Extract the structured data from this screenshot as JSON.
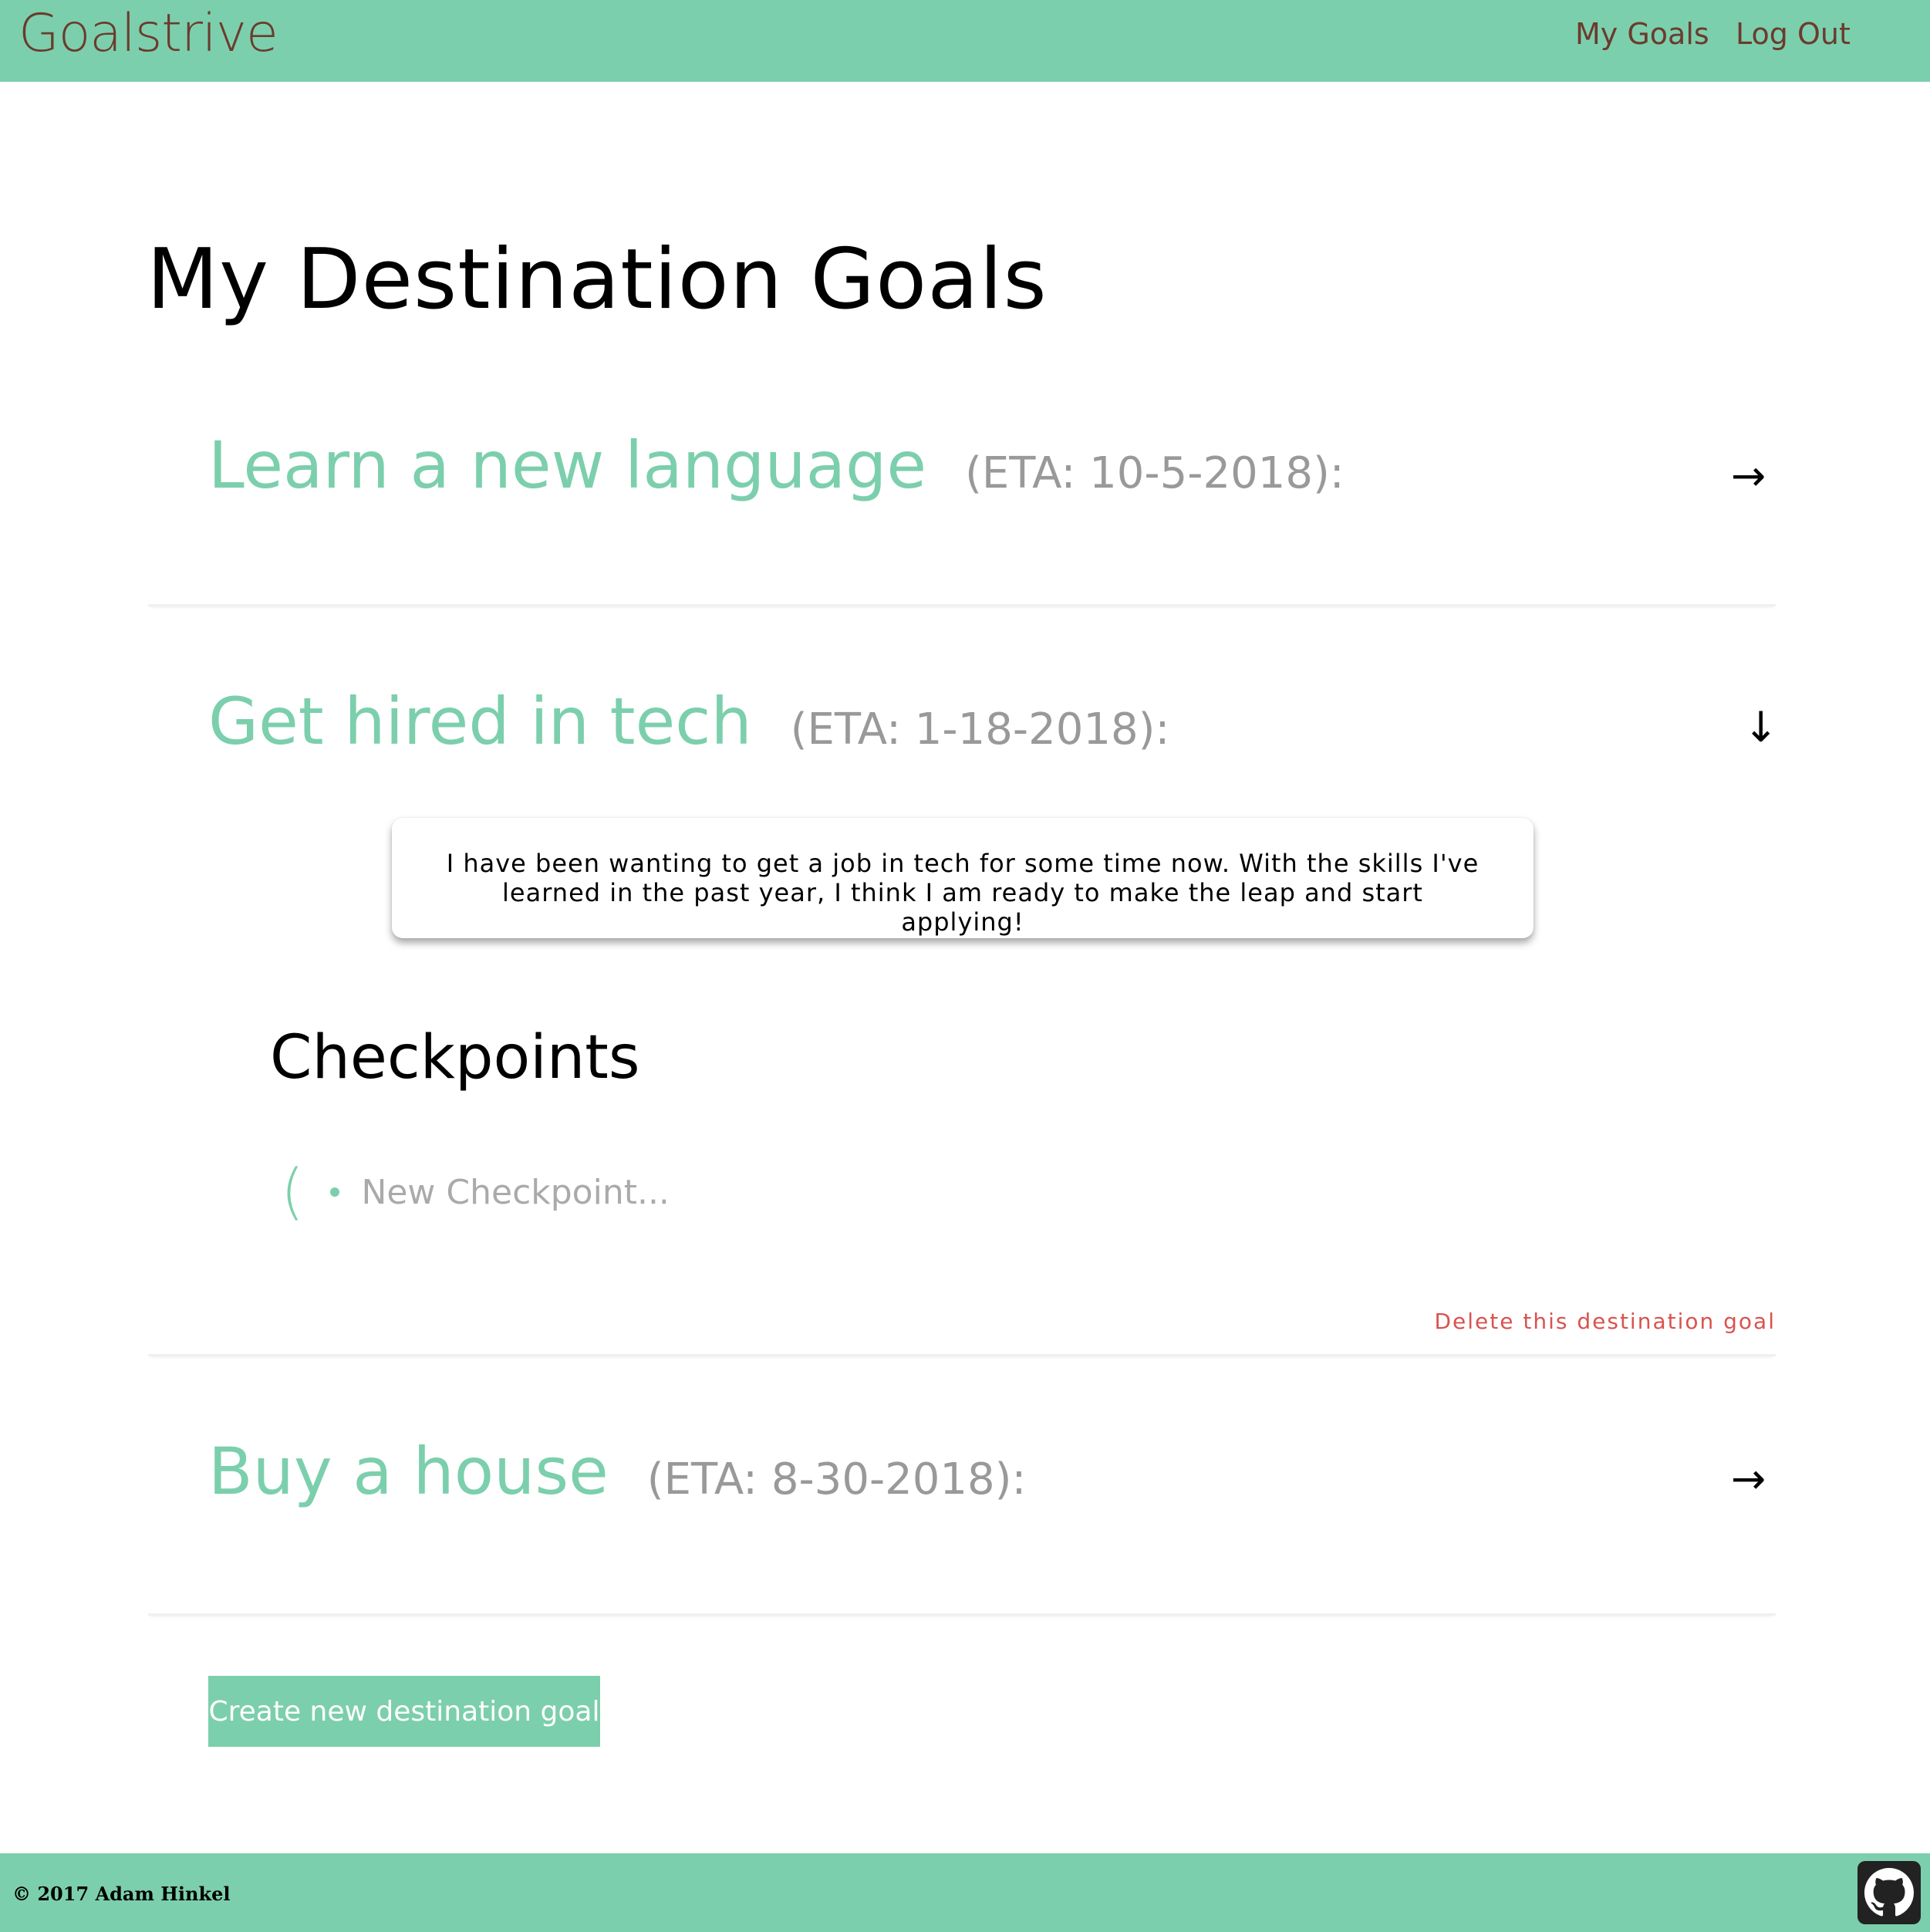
{
  "header": {
    "brand": "Goalstrive",
    "nav": {
      "my_goals": "My Goals",
      "log_out": "Log Out"
    }
  },
  "page_title": "My Destination Goals",
  "goals": [
    {
      "title": "Learn a new language",
      "eta": "(ETA: 10-5-2018):",
      "arrow": "→",
      "expanded": false
    },
    {
      "title": "Get hired in tech",
      "eta": "(ETA: 1-18-2018):",
      "arrow": "↓",
      "expanded": true,
      "description": "I have been wanting to get a job in tech for some time now. With the skills I've learned in the past year, I think I am ready to make the leap and start applying!",
      "checkpoints_title": "Checkpoints",
      "checkpoint_paren": "(",
      "new_checkpoint_placeholder": "New Checkpoint...",
      "delete_label": "Delete this destination goal"
    },
    {
      "title": "Buy a house",
      "eta": "(ETA: 8-30-2018):",
      "arrow": "→",
      "expanded": false
    }
  ],
  "create_button": "Create new destination goal",
  "footer": {
    "copyright": "© 2017 Adam Hinkel",
    "github_icon": "github-icon"
  },
  "colors": {
    "accent": "#7ccfac",
    "brand_text": "#6b3b2e",
    "eta_text": "#999999",
    "danger": "#d9534f"
  }
}
